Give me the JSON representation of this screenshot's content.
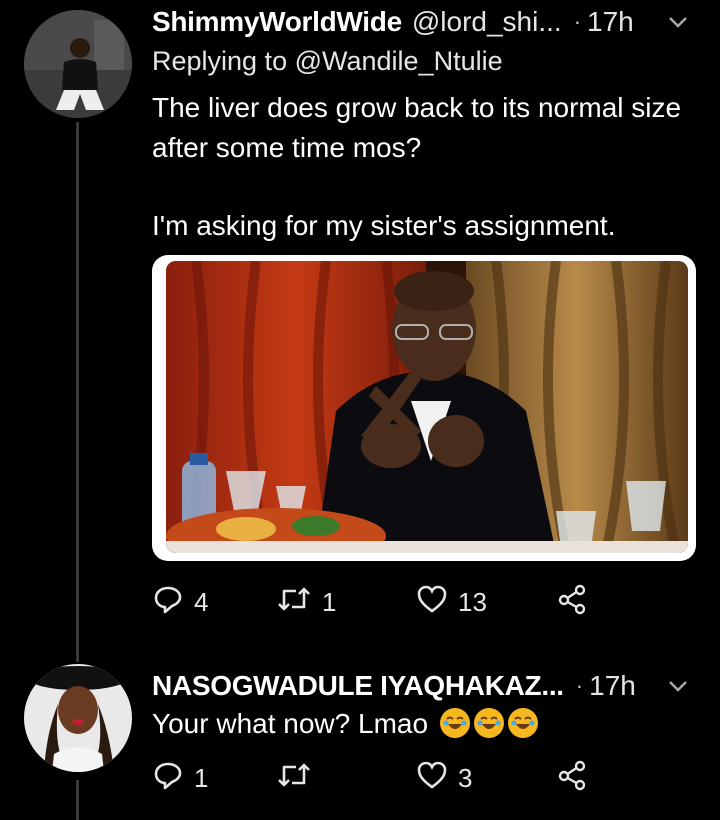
{
  "tweets": [
    {
      "display_name": "ShimmyWorldWide",
      "handle": "@lord_shi...",
      "separator": "·",
      "time": "17h",
      "replying_to_prefix": "Replying to",
      "replying_to_handle": "@Wandile_Ntulie",
      "text_line1": "The liver does grow back to its normal size after some time mos?",
      "text_line2": "I'm asking for my sister's assignment.",
      "replies": "4",
      "retweets": "1",
      "likes": "13"
    },
    {
      "display_name": "NASOGWADULE IYAQHAKAZ...",
      "separator": "·",
      "time": "17h",
      "text": "Your what now? Lmao",
      "emoji_count": 3,
      "emoji_name": "rolling-on-the-floor-laughing",
      "replies": "1",
      "retweets": "",
      "likes": "3"
    }
  ],
  "icons": {
    "reply": "reply-icon",
    "retweet": "retweet-icon",
    "like": "heart-icon",
    "share": "share-icon",
    "more": "chevron-down-icon"
  },
  "colors": {
    "background": "#000000",
    "text": "#ffffff",
    "secondary": "#e6e6e6",
    "thread_line": "#3a3a3a"
  }
}
